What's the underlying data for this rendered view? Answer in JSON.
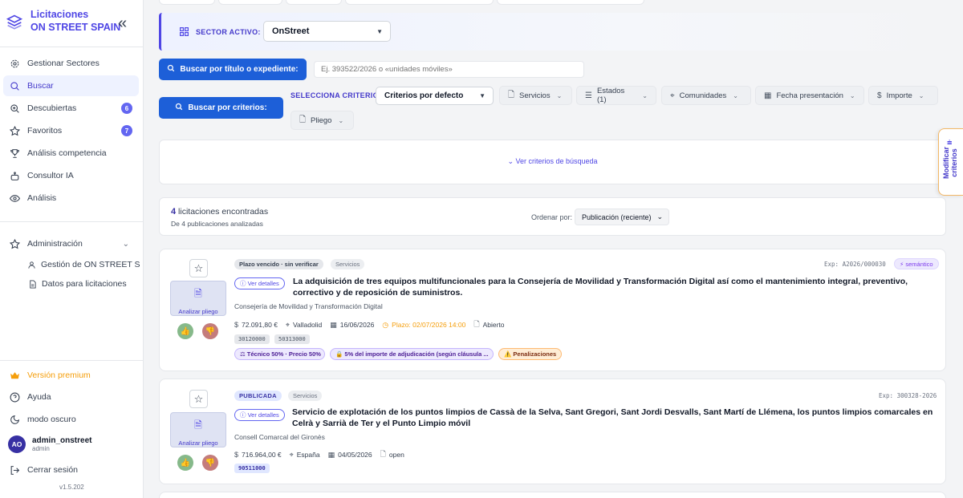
{
  "brand": {
    "line1": "Licitaciones",
    "line2": "ON STREET SPAIN",
    "collapse_icon": "«"
  },
  "nav": {
    "items": [
      {
        "label": "Gestionar Sectores",
        "icon": "gear-icon"
      },
      {
        "label": "Buscar",
        "icon": "search-icon"
      },
      {
        "label": "Descubiertas",
        "icon": "zoom-in-icon",
        "badge": "6"
      },
      {
        "label": "Favoritos",
        "icon": "star-icon",
        "badge": "7"
      },
      {
        "label": "Análisis competencia",
        "icon": "trophy-icon"
      },
      {
        "label": "Consultor IA",
        "icon": "robot-icon"
      },
      {
        "label": "Análisis",
        "icon": "eye-icon"
      }
    ],
    "admin": {
      "label": "Administración",
      "sub": [
        "Gestión de ON STREET SPAIN",
        "Datos para licitaciones"
      ]
    },
    "bottom": {
      "premium": "Versión premium",
      "help": "Ayuda",
      "dark": "modo oscuro",
      "logout": "Cerrar sesión"
    }
  },
  "user": {
    "initials": "AO",
    "name": "admin_onstreet",
    "role": "admin"
  },
  "version": "v1.5.202",
  "sector": {
    "label": "SECTOR ACTIVO:",
    "value": "OnStreet"
  },
  "search": {
    "title_button": "Buscar por título o expediente:",
    "placeholder": "Ej. 393522/2026 o «unidades móviles»",
    "criteria_button": "Buscar por criterios:",
    "criteria_label": "SELECCIONA CRITERIO:",
    "criteria_value": "Criterios por defecto",
    "chips": [
      "Servicios",
      "Estados (1)",
      "Comunidades",
      "Fecha presentación",
      "Importe",
      "Pliego"
    ],
    "see_criteria": "Ver criterios de búsqueda",
    "side_tab": "Modificar criterios"
  },
  "results": {
    "count": "4",
    "count_text": "licitaciones encontradas",
    "analyzed": "De 4 publicaciones analizadas",
    "order_label": "Ordenar por:",
    "order_value": "Publicación (reciente)"
  },
  "cards": [
    {
      "status": "Plazo vencido · sin verificar",
      "type": "Servicios",
      "exp": "Exp: A2026/000030",
      "semantic": "⚡ semántico",
      "details": "Ver detalles",
      "title": "La adquisición de tres equipos multifuncionales para la Consejería de Movilidad y Transformación Digital así como el mantenimiento integral, preventivo, correctivo y de reposición de suministros.",
      "org": "Consejería de Movilidad y Transformación Digital",
      "amount": "72.091,80 €",
      "location": "Valladolid",
      "date": "16/06/2026",
      "deadline": "Plazo: 02/07/2026 14:00",
      "procedure": "Abierto",
      "cpv": [
        "30120000",
        "50313000"
      ],
      "pills": [
        "⚖ Técnico 50% · Precio 50%",
        "🔒 5% del importe de adjudicación (según cláusula ...",
        "⚠️ Penalizaciones"
      ],
      "analyze": "Analizar pliego"
    },
    {
      "status": "PUBLICADA",
      "type": "Servicios",
      "exp": "Exp: 300328-2026",
      "details": "Ver detalles",
      "title": "Servicio de explotación de los puntos limpios de Cassà de la Selva, Sant Gregori, Sant Jordi Desvalls, Sant Martí de Llémena, los puntos limpios comarcales en Celrà y Sarrià de Ter y el Punto Limpio móvil",
      "org": "Consell Comarcal del Gironès",
      "amount": "716.964,00 €",
      "location": "España",
      "date": "04/05/2026",
      "procedure": "open",
      "cpv": [
        "90511000"
      ],
      "analyze": "Analizar pliego"
    }
  ],
  "colors": {
    "primary": "#1d5fd8",
    "accent": "#4f46e5",
    "premium": "#f59e0b"
  }
}
